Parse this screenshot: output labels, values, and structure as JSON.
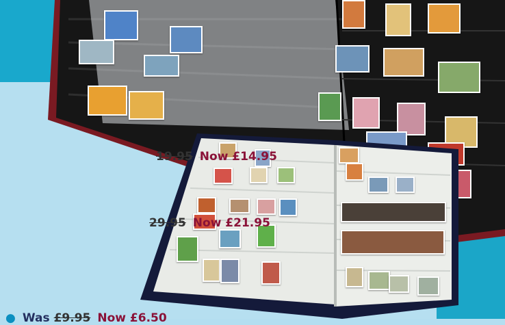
{
  "prices": [
    {
      "was": "19.95",
      "now": "Now £14.95"
    },
    {
      "was": "29.95",
      "now": "Now £21.95"
    },
    {
      "label": "Was",
      "was": "£9.95",
      "now": "Now £6.50"
    }
  ],
  "colors": {
    "teal": "#12a5c9",
    "light_blue": "#b6dff0",
    "price_red": "#8a1238",
    "album_black": "#161616",
    "album_red": "#7a1a22"
  }
}
